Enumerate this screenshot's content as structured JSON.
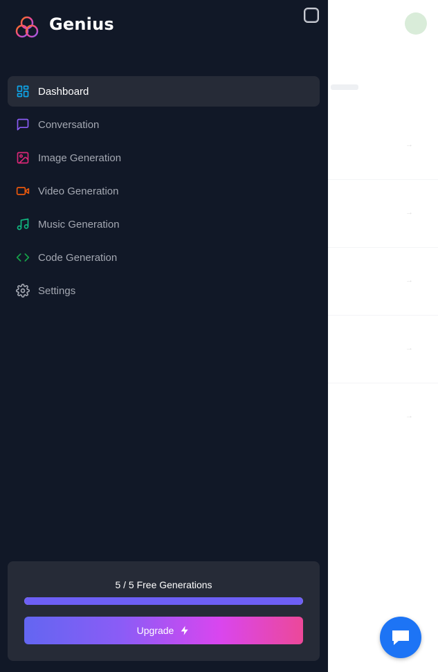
{
  "app": {
    "brand": "Genius"
  },
  "nav": {
    "items": [
      {
        "label": "Dashboard",
        "icon": "dashboard-icon",
        "color": "#0ea5e9",
        "active": true
      },
      {
        "label": "Conversation",
        "icon": "message-square-icon",
        "color": "#8b5cf6",
        "active": false
      },
      {
        "label": "Image Generation",
        "icon": "image-icon",
        "color": "#db2777",
        "active": false
      },
      {
        "label": "Video Generation",
        "icon": "video-icon",
        "color": "#ea580c",
        "active": false
      },
      {
        "label": "Music Generation",
        "icon": "music-icon",
        "color": "#10b981",
        "active": false
      },
      {
        "label": "Code Generation",
        "icon": "code-icon",
        "color": "#16a34a",
        "active": false
      },
      {
        "label": "Settings",
        "icon": "gear-icon",
        "color": "#a4a8b2",
        "active": false
      }
    ]
  },
  "usage": {
    "text": "5 / 5 Free Generations",
    "used": 5,
    "limit": 5,
    "progress_fraction": 1.0
  },
  "upgrade": {
    "label": "Upgrade"
  },
  "colors": {
    "sidebar_bg": "#111827",
    "active_bg": "#262b37",
    "chat_button": "#1d74f5"
  }
}
